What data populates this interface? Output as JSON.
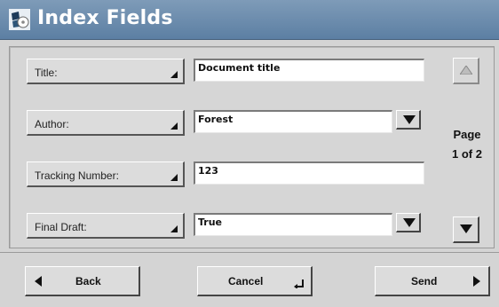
{
  "window": {
    "title": "Index Fields",
    "icon": "scanner-disc-icon"
  },
  "fields": [
    {
      "label": "Title:",
      "value": "Document title",
      "has_dropdown": false
    },
    {
      "label": "Author:",
      "value": "Forest",
      "has_dropdown": true
    },
    {
      "label": "Tracking Number:",
      "value": "123",
      "has_dropdown": false
    },
    {
      "label": "Final Draft:",
      "value": "True",
      "has_dropdown": true
    }
  ],
  "pager": {
    "label": "Page",
    "count": "1 of 2",
    "up_enabled": false,
    "down_enabled": true
  },
  "footer": {
    "back_label": "Back",
    "cancel_label": "Cancel",
    "send_label": "Send"
  },
  "colors": {
    "titlebar": "#5c7fa3",
    "panel": "#d4d4d4"
  }
}
